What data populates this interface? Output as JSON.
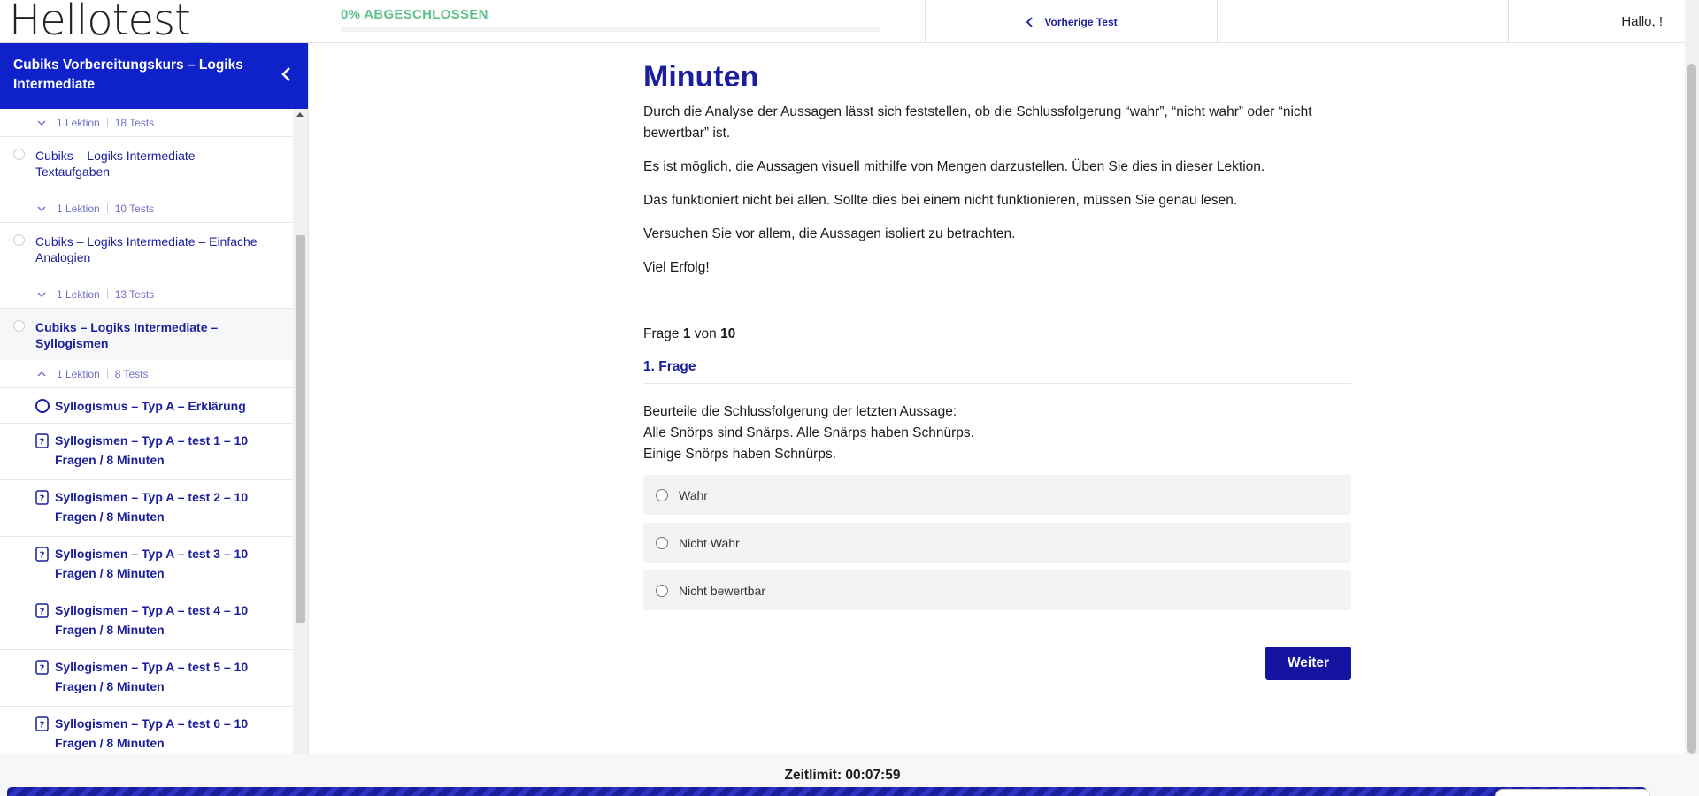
{
  "header": {
    "logo_text": "Hellotest",
    "logo_underscore": "_",
    "progress_label": "0% ABGESCHLOSSEN",
    "progress_percent": 0,
    "prev_test_label": "Vorherige Test",
    "greeting": "Hallo, !"
  },
  "sidebar": {
    "course_title": "Cubiks Vorbereitungskurs – Logiks Intermediate",
    "first_meta": {
      "lessons": "1 Lektion",
      "tests": "18 Tests"
    },
    "topics": [
      {
        "title": "Cubiks – Logiks Intermediate – Textaufgaben",
        "lessons": "1 Lektion",
        "tests": "10 Tests"
      },
      {
        "title": "Cubiks – Logiks Intermediate – Einfache Analogien",
        "lessons": "1 Lektion",
        "tests": "13 Tests"
      },
      {
        "title": "Cubiks – Logiks Intermediate – Syllogismen",
        "lessons": "1 Lektion",
        "tests": "8 Tests"
      }
    ],
    "lessons": [
      "Syllogismus – Typ A – Erklärung",
      "Syllogismen – Typ A – test 1 – 10 Fragen / 8 Minuten",
      "Syllogismen – Typ A – test 2 – 10 Fragen / 8 Minuten",
      "Syllogismen – Typ A – test 3 – 10 Fragen / 8 Minuten",
      "Syllogismen – Typ A – test 4 – 10 Fragen / 8 Minuten",
      "Syllogismen – Typ A – test 5 – 10 Fragen / 8 Minuten",
      "Syllogismen – Typ A – test 6 – 10 Fragen / 8 Minuten"
    ]
  },
  "main": {
    "title": "Minuten",
    "intro": [
      "Durch die Analyse der Aussagen lässt sich feststellen, ob die Schlussfolgerung “wahr”, “nicht wahr” oder “nicht bewertbar” ist.",
      "Es ist möglich, die Aussagen visuell mithilfe von Mengen darzustellen. Üben Sie dies in dieser Lektion.",
      "Das funktioniert nicht bei allen. Sollte dies bei einem nicht funktionieren, müssen Sie genau lesen.",
      "Versuchen Sie vor allem, die Aussagen isoliert zu betrachten.",
      "Viel Erfolg!"
    ],
    "question_counter": {
      "prefix": "Frage",
      "current": "1",
      "middle": "von",
      "total": "10"
    },
    "question_title": "1. Frage",
    "question_text": "Beurteile die Schlussfolgerung der letzten Aussage:\nAlle Snörps sind Snärps. Alle Snärps haben Schnürps.\nEinige Snörps haben Schnürps.",
    "options": [
      "Wahr",
      "Nicht Wahr",
      "Nicht bewertbar"
    ],
    "next_label": "Weiter"
  },
  "footer": {
    "timer_text": "Zeitlimit: 00:07:59"
  },
  "colors": {
    "brand_blue": "#0f22c9",
    "navy": "#1b1f9c",
    "green": "#5fc18a"
  }
}
